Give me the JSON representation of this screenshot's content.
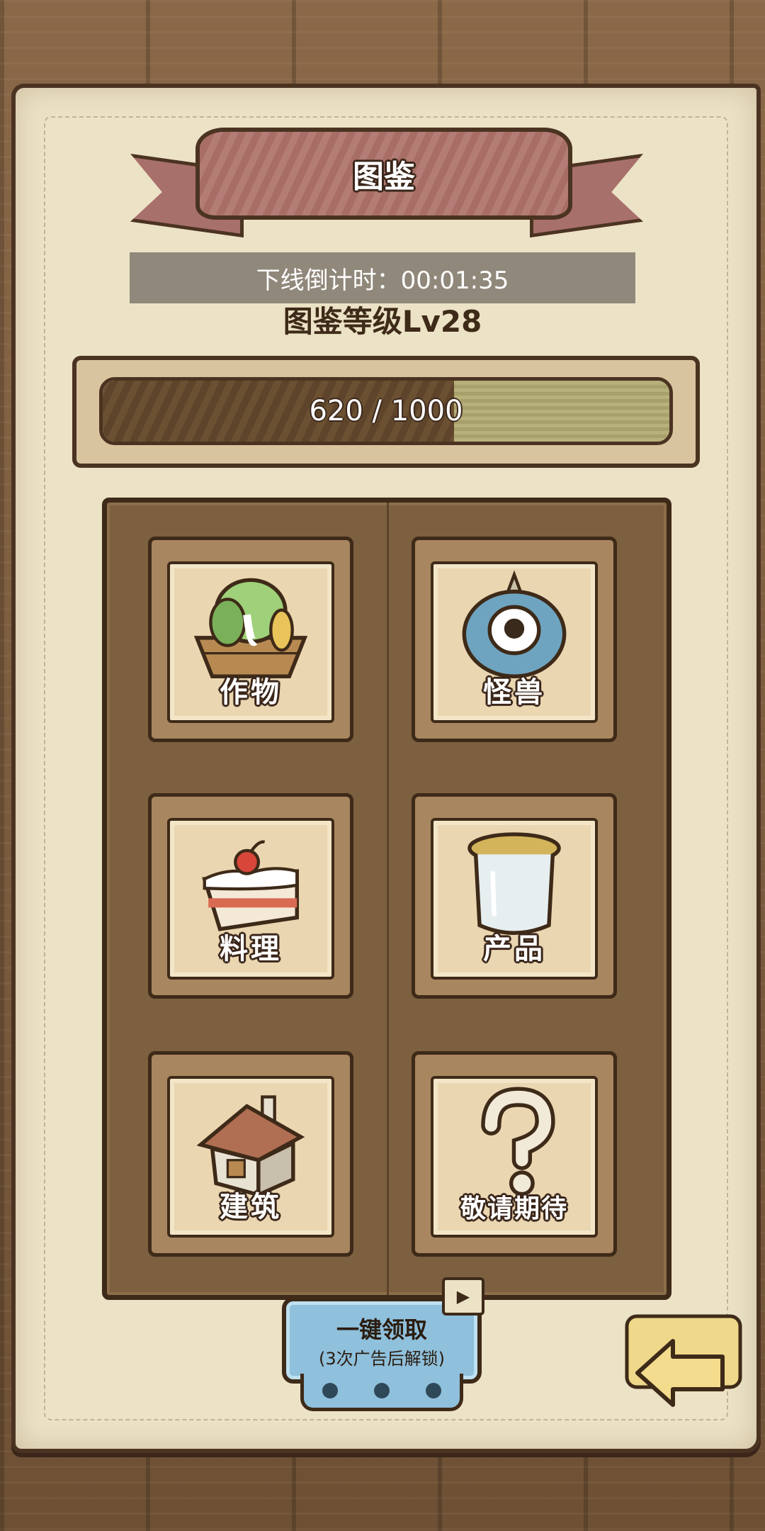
{
  "title": "图鉴",
  "countdown": "下线倒计时：00:01:35",
  "level_title": "图鉴等级Lv28",
  "progress": {
    "current": 620,
    "max": 1000,
    "text": "620 / 1000"
  },
  "categories": [
    {
      "label": "作物",
      "icon": "crops-basket-icon"
    },
    {
      "label": "怪兽",
      "icon": "monster-eye-icon"
    },
    {
      "label": "料理",
      "icon": "cake-icon"
    },
    {
      "label": "产品",
      "icon": "jar-icon"
    },
    {
      "label": "建筑",
      "icon": "house-icon"
    },
    {
      "label": "敬请期待",
      "icon": "question-mark-icon"
    }
  ],
  "claim_button": {
    "label": "一键领取",
    "sublabel": "(3次广告后解锁)"
  },
  "colors": {
    "paper": "#ece2c6",
    "ribbon": "#b37c74",
    "board": "#7c6040",
    "button_blue": "#8fc0dc",
    "back_button": "#f0d88a"
  }
}
